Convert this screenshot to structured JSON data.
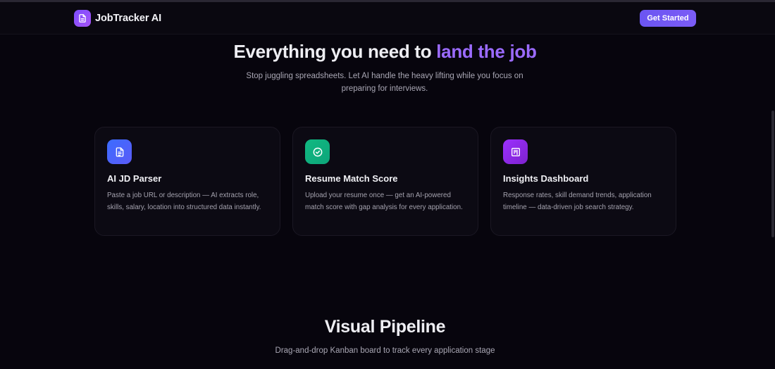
{
  "brand": {
    "name": "JobTracker AI",
    "icon": "document-icon"
  },
  "nav": {
    "cta_label": "Get Started"
  },
  "hero": {
    "title_start": "Everything you need to ",
    "title_accent": "land the job",
    "subtitle": "Stop juggling spreadsheets. Let AI handle the heavy lifting while you focus on preparing for interviews."
  },
  "features": [
    {
      "title": "AI JD Parser",
      "description": "Paste a job URL or description — AI extracts role, skills, salary, location into structured data instantly.",
      "icon": "document-icon",
      "color": "#4f6bff"
    },
    {
      "title": "Resume Match Score",
      "description": "Upload your resume once — get an AI-powered match score with gap analysis for every application.",
      "icon": "check-circle-icon",
      "color": "#10b981"
    },
    {
      "title": "Insights Dashboard",
      "description": "Response rates, skill demand trends, application timeline — data-driven job search strategy.",
      "icon": "chart-icon",
      "color": "#9333ea"
    }
  ],
  "pipeline": {
    "title": "Visual Pipeline",
    "subtitle": "Drag-and-drop Kanban board to track every application stage"
  },
  "colors": {
    "accent": "#9b6bff",
    "cta": "#6b55f2",
    "background": "#07050d"
  }
}
